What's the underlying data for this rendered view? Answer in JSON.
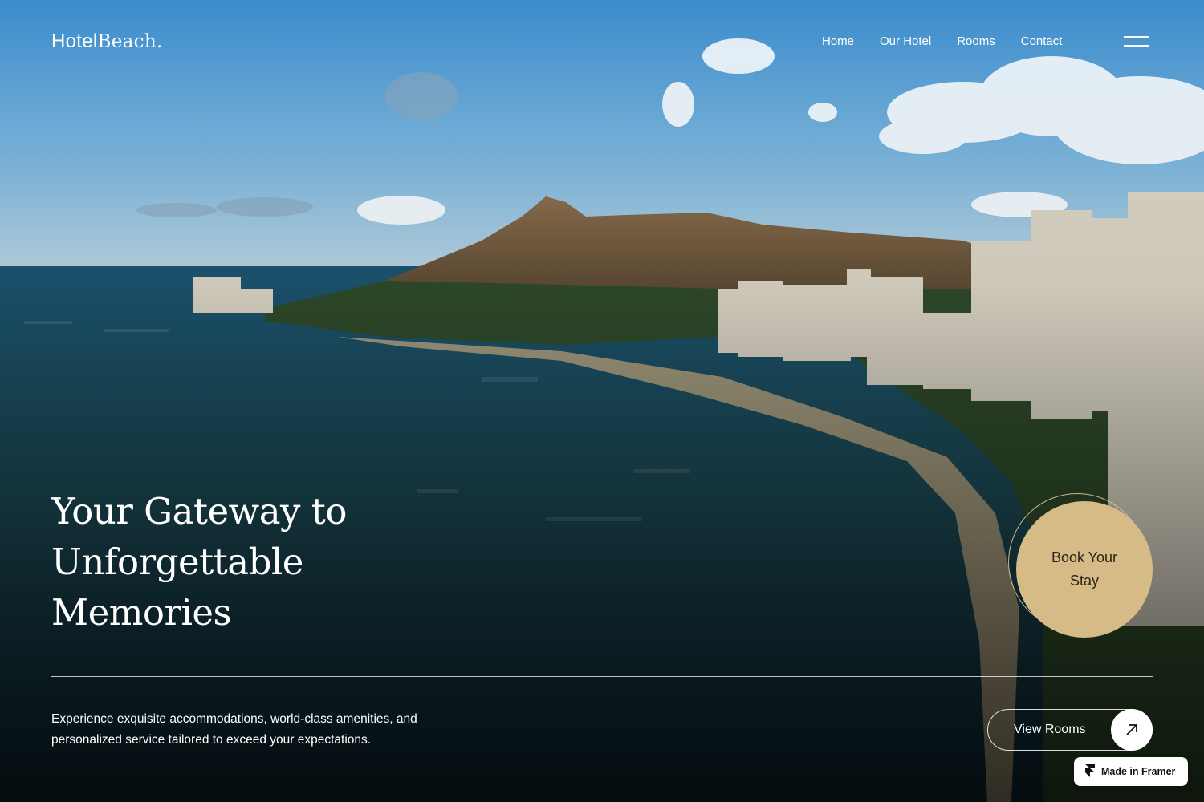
{
  "brand": {
    "logo_part1": "Hotel",
    "logo_part2": "Beach."
  },
  "nav": {
    "items": [
      {
        "label": "Home"
      },
      {
        "label": "Our Hotel"
      },
      {
        "label": "Rooms"
      },
      {
        "label": "Contact"
      }
    ],
    "menu_icon": "hamburger-icon"
  },
  "hero": {
    "headline": "Your Gateway to Unforgettable Memories",
    "description": "Experience exquisite accommodations, world-class amenities, and personalized service tailored to exceed your expectations.",
    "book_label": "Book Your Stay",
    "view_rooms_label": "View Rooms",
    "view_rooms_icon": "arrow-up-right-icon"
  },
  "badge": {
    "label": "Made in Framer",
    "icon": "framer-icon"
  },
  "colors": {
    "accent": "#d6bb86",
    "text": "#ffffff"
  }
}
